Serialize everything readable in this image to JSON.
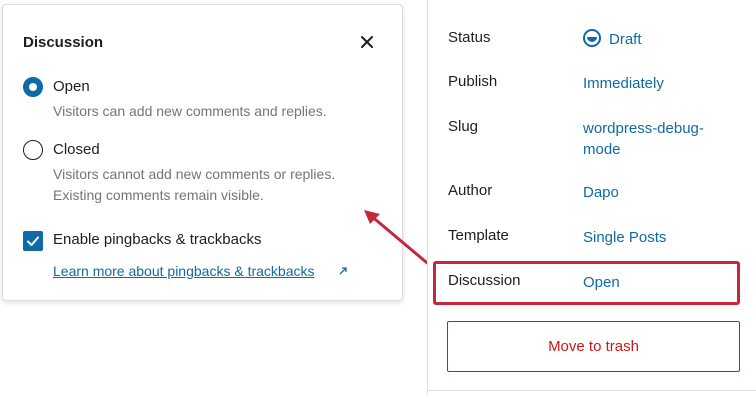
{
  "popover": {
    "title": "Discussion",
    "close_icon": "close-icon",
    "options": [
      {
        "label": "Open",
        "help": "Visitors can add new comments and replies.",
        "checked": true
      },
      {
        "label": "Closed",
        "help": "Visitors cannot add new comments or replies. Existing comments remain visible.",
        "checked": false
      }
    ],
    "pingbacks": {
      "label": "Enable pingbacks & trackbacks",
      "checked": true
    },
    "learn_more": {
      "label": "Learn more about pingbacks & trackbacks",
      "icon": "external-link-icon"
    }
  },
  "sidebar": {
    "rows": [
      {
        "label": "Status",
        "value": "Draft",
        "icon": "status-draft-icon"
      },
      {
        "label": "Publish",
        "value": "Immediately"
      },
      {
        "label": "Slug",
        "value": "wordpress-debug-mode"
      },
      {
        "label": "Author",
        "value": "Dapo"
      },
      {
        "label": "Template",
        "value": "Single Posts"
      },
      {
        "label": "Discussion",
        "value": "Open"
      }
    ],
    "trash_label": "Move to trash"
  },
  "colors": {
    "accent": "#0f6aa6",
    "highlight": "#c4283a",
    "danger": "#cc1818",
    "muted_text": "#757575"
  }
}
